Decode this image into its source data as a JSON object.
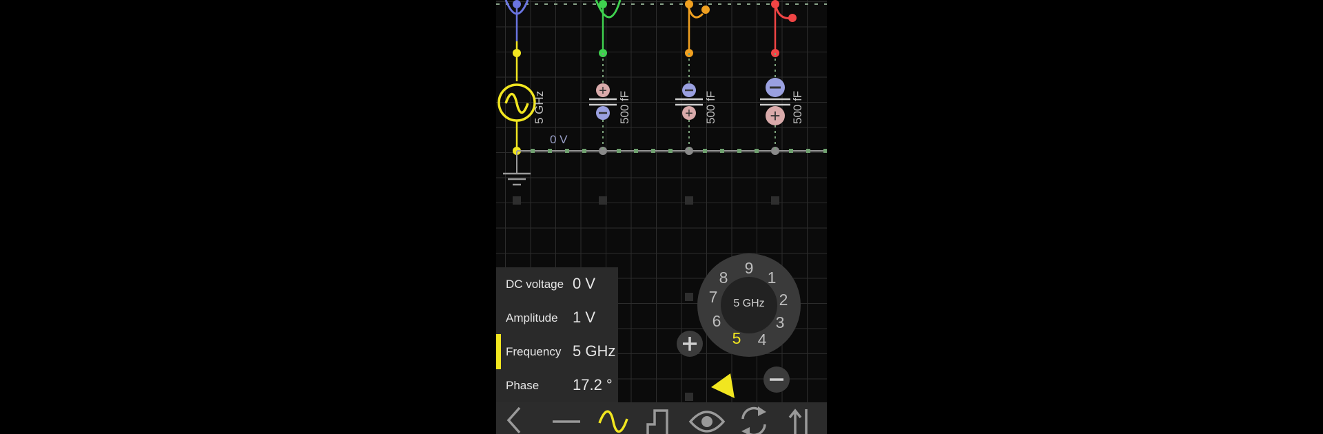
{
  "circuit": {
    "source_label": "5 GHz",
    "node_label": "0 V",
    "capacitors": [
      {
        "label": "500 fF",
        "top_sign": "+",
        "bottom_sign": "-",
        "wire_color": "#3fd14f"
      },
      {
        "label": "500 fF",
        "top_sign": "-",
        "bottom_sign": "+",
        "wire_color": "#f0a020"
      },
      {
        "label": "500 fF",
        "top_sign": "-",
        "bottom_sign": "+",
        "wire_color": "#f04545"
      }
    ],
    "colors": {
      "source": "#f1e620",
      "probe_blue": "#6a74e0",
      "grid": "#2a2a2a",
      "wire": "#9a9a9a"
    }
  },
  "properties": [
    {
      "label": "DC voltage",
      "value": "0 V"
    },
    {
      "label": "Amplitude",
      "value": "1 V"
    },
    {
      "label": "Frequency",
      "value": "5 GHz",
      "selected": true
    },
    {
      "label": "Phase",
      "value": "17.2 °"
    }
  ],
  "dial": {
    "center_label": "5 GHz",
    "digits": [
      "9",
      "1",
      "2",
      "3",
      "4",
      "5",
      "6",
      "7",
      "8"
    ],
    "active_digit": "5"
  },
  "toolbar": {
    "icons": [
      "back-icon",
      "dc-source-icon",
      "ac-source-icon",
      "pulse-source-icon",
      "eye-icon",
      "cycle-icon",
      "swap-icon"
    ],
    "accent": "#f1e620"
  }
}
